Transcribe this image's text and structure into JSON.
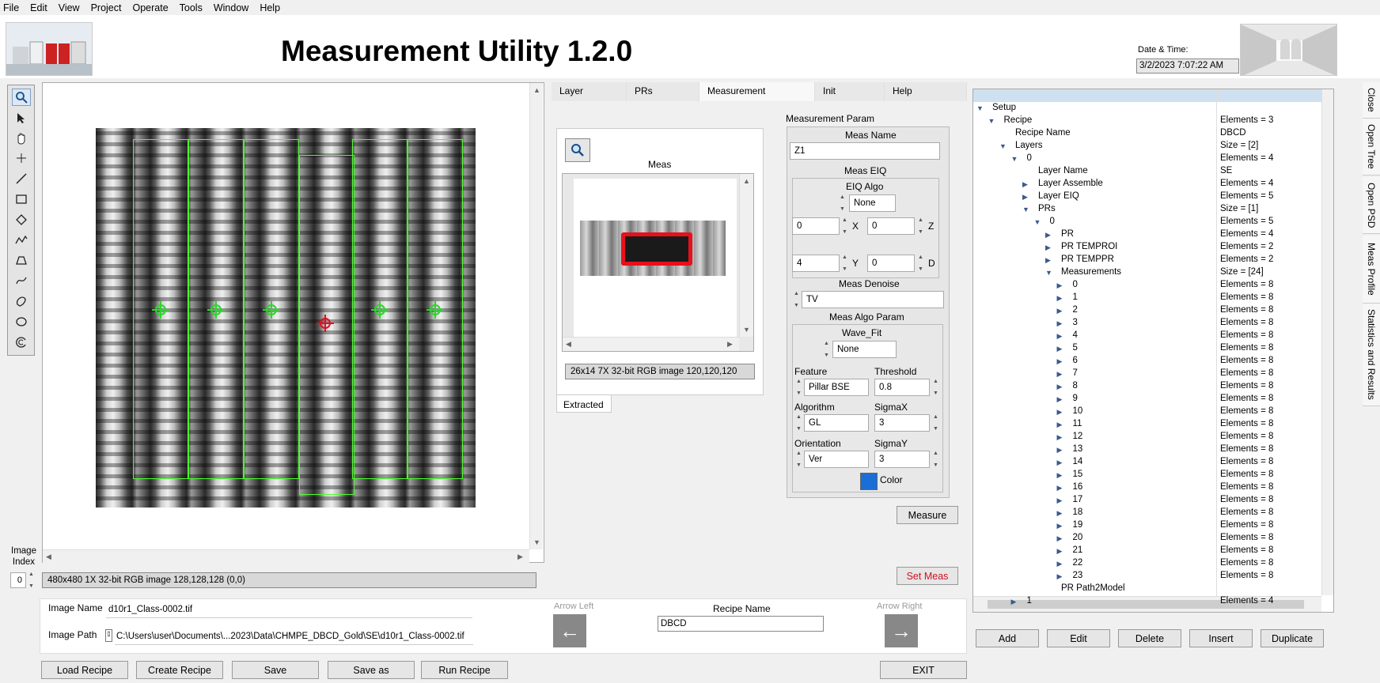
{
  "menu": [
    "File",
    "Edit",
    "View",
    "Project",
    "Operate",
    "Tools",
    "Window",
    "Help"
  ],
  "app": {
    "title": "Measurement Utility 1.2.0",
    "datetime_label": "Date & Time:",
    "datetime_value": "3/2/2023 7:07:22 AM"
  },
  "tools": [
    "zoom-icon",
    "pointer-icon",
    "pan-hand-icon",
    "crosshair-icon",
    "line-icon",
    "rectangle-icon",
    "rotated-rect-icon",
    "polyline-icon",
    "polygon-icon",
    "freehand-icon",
    "freehand-region-icon",
    "oval-icon",
    "annulus-icon"
  ],
  "image_display": {
    "status": "480x480 1X 32-bit RGB image 128,128,128     (0,0)",
    "image_index_label": "Image\nIndex",
    "image_index_value": "0"
  },
  "tabs": [
    "Layer",
    "PRs",
    "Measurement",
    "Init",
    "Help"
  ],
  "active_tab": "Measurement",
  "meas_preview": {
    "title": "Meas",
    "status": "26x14 7X 32-bit RGB image 120,120,120",
    "subtab": "Extracted"
  },
  "meas_param": {
    "section_title": "Measurement Param",
    "meas_name_label": "Meas Name",
    "meas_name_value": "Z1",
    "eiq_label": "Meas EIQ",
    "eiq_algo_label": "EIQ Algo",
    "eiq_algo_value": "None",
    "x_value": "0",
    "x_label": "X",
    "z_value": "0",
    "z_label": "Z",
    "y_value": "4",
    "y_label": "Y",
    "d_value": "0",
    "d_label": "D",
    "denoise_label": "Meas Denoise",
    "denoise_value": "TV",
    "algo_param_label": "Meas Algo Param",
    "wave_fit_label": "Wave_Fit",
    "wave_fit_value": "None",
    "feature_label": "Feature",
    "feature_value": "Pillar BSE",
    "threshold_label": "Threshold",
    "threshold_value": "0.8",
    "algorithm_label": "Algorithm",
    "algorithm_value": "GL",
    "sigmax_label": "SigmaX",
    "sigmax_value": "3",
    "orientation_label": "Orientation",
    "orientation_value": "Ver",
    "sigmay_label": "SigmaY",
    "sigmay_value": "3",
    "color_label": "Color",
    "color_value": "#1a6fd6",
    "measure_button": "Measure",
    "set_meas_button": "Set Meas"
  },
  "tree": {
    "rows": [
      {
        "indent": 0,
        "expander": "open",
        "label": "Setup",
        "value": ""
      },
      {
        "indent": 1,
        "expander": "open",
        "label": "Recipe",
        "value": "Elements = 3"
      },
      {
        "indent": 2,
        "expander": "",
        "label": "Recipe Name",
        "value": "DBCD"
      },
      {
        "indent": 2,
        "expander": "open",
        "label": "Layers",
        "value": "Size = [2]"
      },
      {
        "indent": 3,
        "expander": "open",
        "label": "0",
        "value": "Elements = 4"
      },
      {
        "indent": 4,
        "expander": "",
        "label": "Layer Name",
        "value": "SE"
      },
      {
        "indent": 4,
        "expander": "closed",
        "label": "Layer Assemble",
        "value": "Elements = 4"
      },
      {
        "indent": 4,
        "expander": "closed",
        "label": "Layer EIQ",
        "value": "Elements = 5"
      },
      {
        "indent": 4,
        "expander": "open",
        "label": "PRs",
        "value": "Size = [1]"
      },
      {
        "indent": 5,
        "expander": "open",
        "label": "0",
        "value": "Elements = 5"
      },
      {
        "indent": 6,
        "expander": "closed",
        "label": "PR",
        "value": "Elements = 4"
      },
      {
        "indent": 6,
        "expander": "closed",
        "label": "PR TEMPROI",
        "value": "Elements = 2"
      },
      {
        "indent": 6,
        "expander": "closed",
        "label": "PR TEMPPR",
        "value": "Elements = 2"
      },
      {
        "indent": 6,
        "expander": "open",
        "label": "Measurements",
        "value": "Size = [24]"
      },
      {
        "indent": 7,
        "expander": "closed",
        "label": "0",
        "value": "Elements = 8"
      },
      {
        "indent": 7,
        "expander": "closed",
        "label": "1",
        "value": "Elements = 8"
      },
      {
        "indent": 7,
        "expander": "closed",
        "label": "2",
        "value": "Elements = 8"
      },
      {
        "indent": 7,
        "expander": "closed",
        "label": "3",
        "value": "Elements = 8"
      },
      {
        "indent": 7,
        "expander": "closed",
        "label": "4",
        "value": "Elements = 8"
      },
      {
        "indent": 7,
        "expander": "closed",
        "label": "5",
        "value": "Elements = 8"
      },
      {
        "indent": 7,
        "expander": "closed",
        "label": "6",
        "value": "Elements = 8"
      },
      {
        "indent": 7,
        "expander": "closed",
        "label": "7",
        "value": "Elements = 8"
      },
      {
        "indent": 7,
        "expander": "closed",
        "label": "8",
        "value": "Elements = 8"
      },
      {
        "indent": 7,
        "expander": "closed",
        "label": "9",
        "value": "Elements = 8"
      },
      {
        "indent": 7,
        "expander": "closed",
        "label": "10",
        "value": "Elements = 8"
      },
      {
        "indent": 7,
        "expander": "closed",
        "label": "11",
        "value": "Elements = 8"
      },
      {
        "indent": 7,
        "expander": "closed",
        "label": "12",
        "value": "Elements = 8"
      },
      {
        "indent": 7,
        "expander": "closed",
        "label": "13",
        "value": "Elements = 8"
      },
      {
        "indent": 7,
        "expander": "closed",
        "label": "14",
        "value": "Elements = 8"
      },
      {
        "indent": 7,
        "expander": "closed",
        "label": "15",
        "value": "Elements = 8"
      },
      {
        "indent": 7,
        "expander": "closed",
        "label": "16",
        "value": "Elements = 8"
      },
      {
        "indent": 7,
        "expander": "closed",
        "label": "17",
        "value": "Elements = 8"
      },
      {
        "indent": 7,
        "expander": "closed",
        "label": "18",
        "value": "Elements = 8"
      },
      {
        "indent": 7,
        "expander": "closed",
        "label": "19",
        "value": "Elements = 8"
      },
      {
        "indent": 7,
        "expander": "closed",
        "label": "20",
        "value": "Elements = 8"
      },
      {
        "indent": 7,
        "expander": "closed",
        "label": "21",
        "value": "Elements = 8"
      },
      {
        "indent": 7,
        "expander": "closed",
        "label": "22",
        "value": "Elements = 8"
      },
      {
        "indent": 7,
        "expander": "closed",
        "label": "23",
        "value": "Elements = 8"
      },
      {
        "indent": 6,
        "expander": "",
        "label": "PR Path2Model",
        "value": ""
      },
      {
        "indent": 3,
        "expander": "closed",
        "label": "1",
        "value": "Elements = 4"
      }
    ],
    "buttons": [
      "Add",
      "Edit",
      "Delete",
      "Insert",
      "Duplicate"
    ]
  },
  "side_tabs": [
    "Close",
    "Open Tree",
    "Open PSD",
    "Meas Profile",
    "Statistics and Results"
  ],
  "image_info": {
    "name_label": "Image Name",
    "name_value": "d10r1_Class-0002.tif",
    "path_label": "Image Path",
    "path_value": "C:\\Users\\user\\Documents\\...2023\\Data\\CHMPE_DBCD_Gold\\SE\\d10r1_Class-0002.tif",
    "arrow_left_label": "Arrow Left",
    "arrow_right_label": "Arrow Right",
    "recipe_name_label": "Recipe Name",
    "recipe_name_value": "DBCD"
  },
  "bottom_buttons": {
    "load": "Load Recipe",
    "create": "Create Recipe",
    "save": "Save",
    "save_as": "Save as",
    "run": "Run Recipe",
    "exit": "EXIT"
  }
}
